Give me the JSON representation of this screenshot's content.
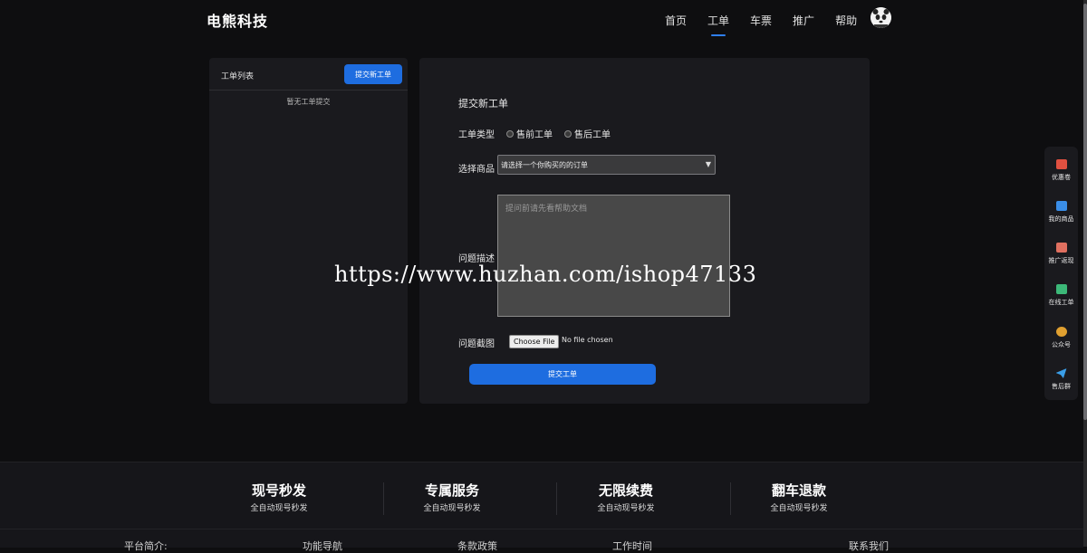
{
  "header": {
    "brand": "电熊科技",
    "nav": [
      {
        "label": "首页",
        "active": false
      },
      {
        "label": "工单",
        "active": true
      },
      {
        "label": "车票",
        "active": false
      },
      {
        "label": "推广",
        "active": false
      },
      {
        "label": "帮助",
        "active": false
      }
    ]
  },
  "ticket_list": {
    "title": "工单列表",
    "new_button": "提交新工单",
    "empty_text": "暂无工单提交"
  },
  "form": {
    "title": "提交新工单",
    "type_label": "工单类型",
    "type_options": [
      "售前工单",
      "售后工单"
    ],
    "product_label": "选择商品",
    "product_select_value": "请选择一个你购买的的订单",
    "description_label": "问题描述",
    "description_placeholder": "提问前请先看帮助文档",
    "screenshot_label": "问题截图",
    "file_button": "Choose File",
    "file_status": "No file chosen",
    "submit_button": "提交工单"
  },
  "watermark": "https://www.huzhan.com/ishop47133",
  "side_dock": [
    {
      "label": "优惠卷",
      "icon": "coupon-icon",
      "color": "#e05040"
    },
    {
      "label": "我的商品",
      "icon": "bag-icon",
      "color": "#3a8ee8"
    },
    {
      "label": "推广返现",
      "icon": "gift-icon",
      "color": "#e07060"
    },
    {
      "label": "在线工单",
      "icon": "clipboard-icon",
      "color": "#3cb878"
    },
    {
      "label": "公众号",
      "icon": "wechat-icon",
      "color": "#e0a030"
    },
    {
      "label": "售后群",
      "icon": "telegram-icon",
      "color": "#3a9ee8"
    }
  ],
  "footer": {
    "features": [
      {
        "title": "现号秒发",
        "subtitle": "全自动现号秒发"
      },
      {
        "title": "专属服务",
        "subtitle": "全自动现号秒发"
      },
      {
        "title": "无限续费",
        "subtitle": "全自动现号秒发"
      },
      {
        "title": "翻车退款",
        "subtitle": "全自动现号秒发"
      }
    ],
    "links": [
      "平台简介:",
      "功能导航",
      "条款政策",
      "工作时间",
      "联系我们"
    ]
  }
}
